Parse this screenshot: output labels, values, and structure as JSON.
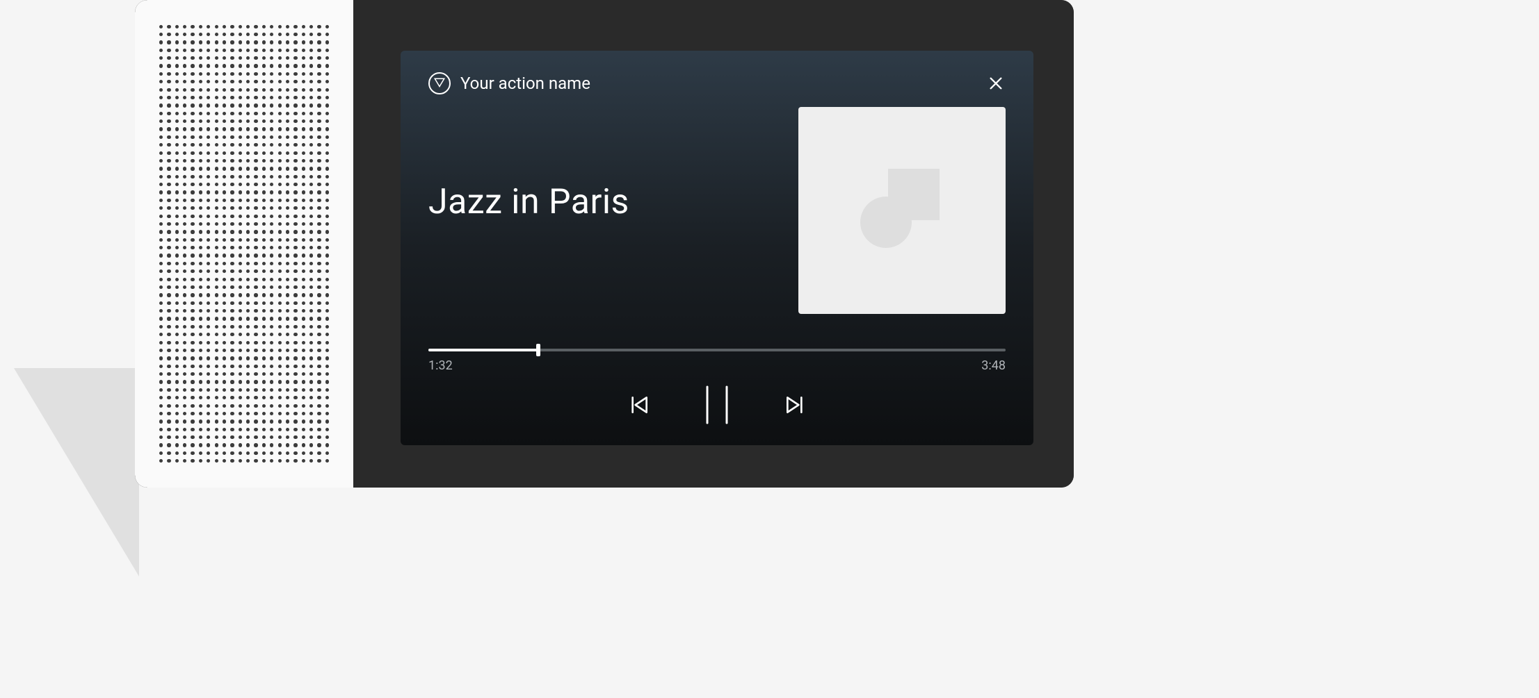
{
  "header": {
    "action_name": "Your action name"
  },
  "track": {
    "title": "Jazz in Paris"
  },
  "progress": {
    "current_time": "1:32",
    "total_time": "3:48",
    "percent": 19
  },
  "icons": {
    "close": "close-icon",
    "prev": "skip-previous-icon",
    "pause": "pause-icon",
    "next": "skip-next-icon",
    "action": "action-logo-icon",
    "album": "album-placeholder-icon",
    "rec": "recording-indicator"
  }
}
